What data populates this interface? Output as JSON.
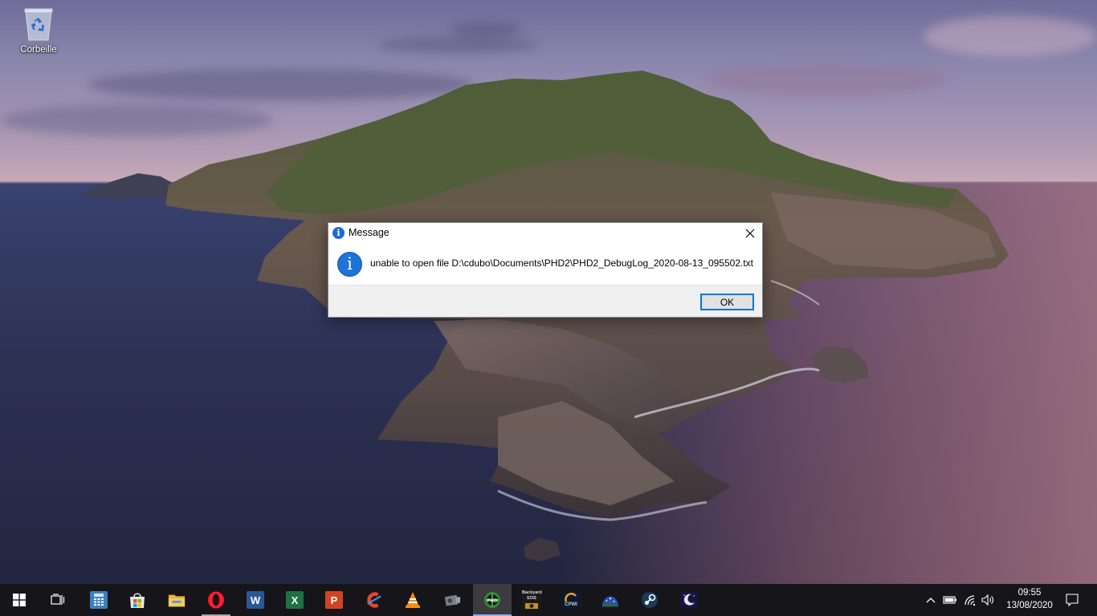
{
  "desktop": {
    "icons": [
      {
        "label": "Corbeille",
        "icon": "recycle-bin-icon"
      }
    ]
  },
  "dialog": {
    "title": "Message",
    "message": "unable to open file D:\\cdubo\\Documents\\PHD2\\PHD2_DebugLog_2020-08-13_095502.txt",
    "ok_label": "OK",
    "icon": "info-icon",
    "close_glyph": "✕"
  },
  "taskbar": {
    "start_icon": "windows-start-icon",
    "task_view_icon": "task-view-icon",
    "apps": [
      {
        "name": "calculator",
        "icon": "calculator-icon",
        "running": false
      },
      {
        "name": "microsoft-store",
        "icon": "store-icon",
        "running": false
      },
      {
        "name": "file-explorer",
        "icon": "folder-icon",
        "running": false
      },
      {
        "name": "opera",
        "icon": "opera-icon",
        "running": true
      },
      {
        "name": "word",
        "icon": "word-icon",
        "glyph": "W",
        "running": false
      },
      {
        "name": "excel",
        "icon": "excel-icon",
        "glyph": "X",
        "running": false
      },
      {
        "name": "powerpoint",
        "icon": "powerpoint-icon",
        "glyph": "P",
        "running": false
      },
      {
        "name": "ccleaner",
        "icon": "ccleaner-icon",
        "running": false
      },
      {
        "name": "vlc",
        "icon": "vlc-icon",
        "running": false
      },
      {
        "name": "camera-app",
        "icon": "camera-icon",
        "running": false
      },
      {
        "name": "phd2",
        "icon": "phd2-icon",
        "running": true,
        "active": true
      },
      {
        "name": "backyard-eos",
        "icon": "backyard-eos-icon",
        "text": "Backyard EOS",
        "running": false
      },
      {
        "name": "cpwi",
        "icon": "cpwi-icon",
        "text": "CPWI",
        "running": false
      },
      {
        "name": "stellarium",
        "icon": "stellarium-icon",
        "running": false
      },
      {
        "name": "steam",
        "icon": "steam-icon",
        "running": false
      },
      {
        "name": "astro-app",
        "icon": "moon-app-icon",
        "running": false
      }
    ],
    "tray": {
      "chevron_icon": "chevron-up-icon",
      "battery_icon": "battery-icon",
      "wifi_icon": "wifi-icon",
      "volume_icon": "volume-icon",
      "time": "09:55",
      "date": "13/08/2020",
      "notification_icon": "notification-icon"
    }
  },
  "colors": {
    "taskbar_bg": "#16161a",
    "accent": "#0078d7",
    "info_blue": "#1e73d8"
  }
}
